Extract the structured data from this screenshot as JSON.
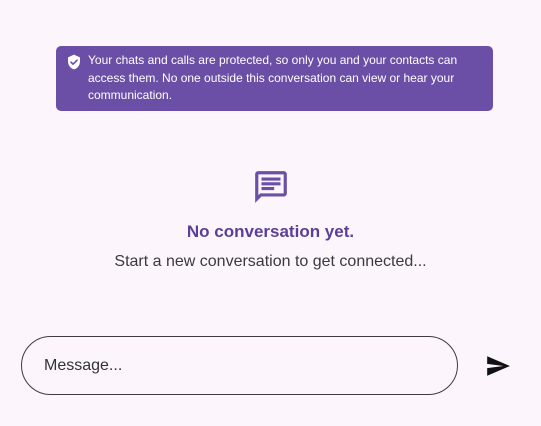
{
  "banner": {
    "icon": "shield-check-icon",
    "text": "Your chats and calls are protected, so only you and your contacts can access them. No one outside this conversation can view or hear your communication."
  },
  "empty_state": {
    "icon": "chat-icon",
    "title": "No conversation yet.",
    "subtitle": "Start a new conversation to get connected..."
  },
  "composer": {
    "placeholder": "Message...",
    "value": "",
    "send_icon": "send-icon"
  },
  "colors": {
    "background": "#fcf6fc",
    "accent": "#6b4fa6",
    "title": "#5b3f96"
  }
}
